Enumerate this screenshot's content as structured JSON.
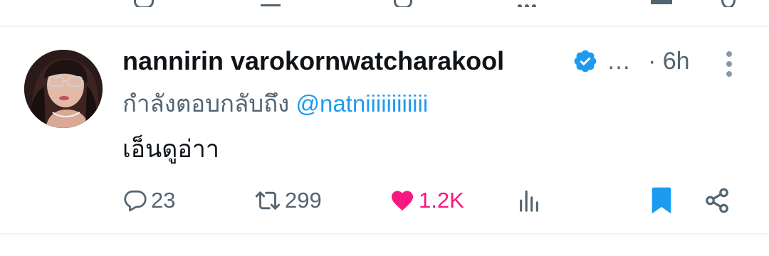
{
  "tweet": {
    "author": {
      "display_name": "nannirin varokornwatcharakool",
      "verified": true,
      "verified_color": "#1d9bf0"
    },
    "ellipsis": "…",
    "time": "· 6h",
    "replying_prefix": "กำลังตอบกลับถึง",
    "replying_handle": "@natniiiiiiiiiiii",
    "text": "เอ็นดูอ่าา",
    "actions": {
      "reply_count": "23",
      "retweet_count": "299",
      "like_count": "1.2K",
      "liked": true,
      "like_color": "#f91880",
      "bookmarked": true,
      "bookmark_color": "#1d9bf0",
      "icons": [
        "reply-icon",
        "retweet-icon",
        "heart-icon",
        "views-icon",
        "bookmark-icon",
        "share-icon"
      ]
    }
  }
}
